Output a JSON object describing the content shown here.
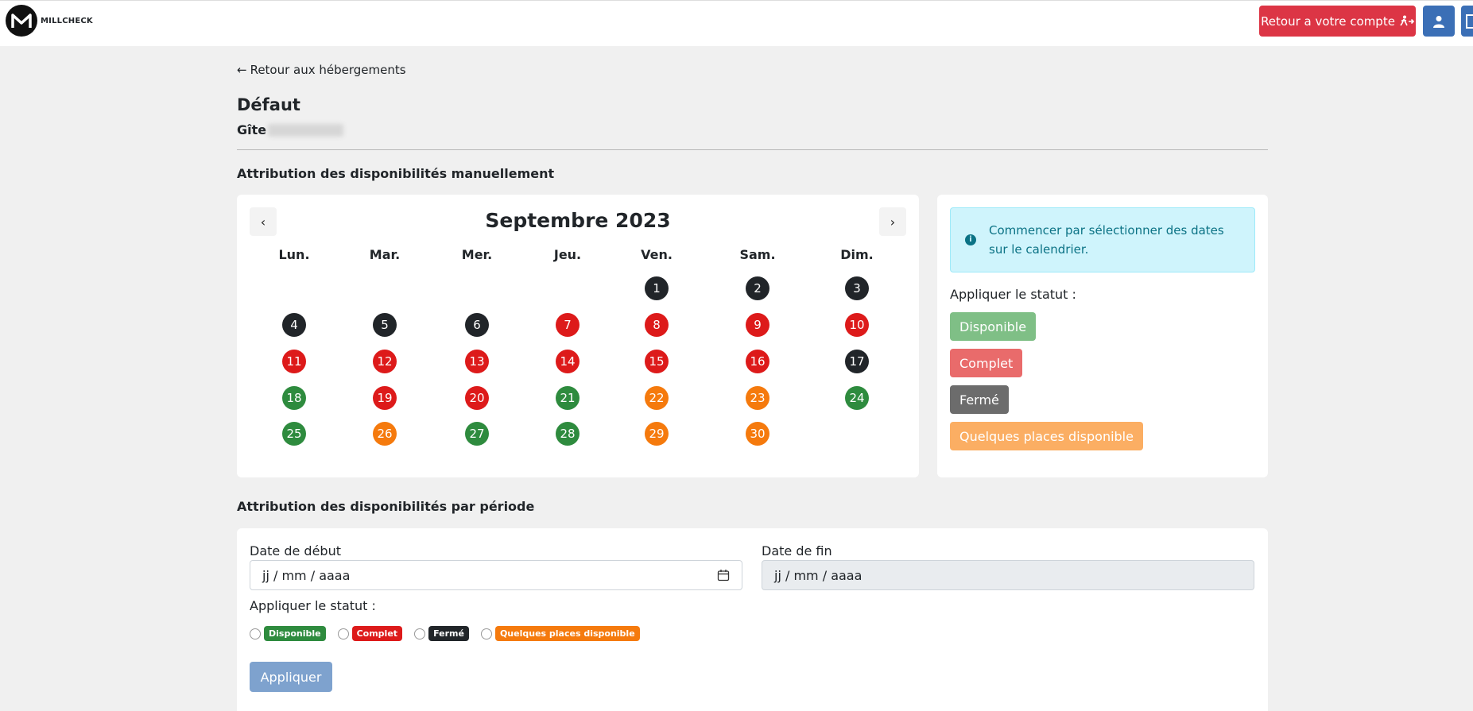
{
  "header": {
    "logo_text": "MILLCHECK",
    "return_button": "Retour a votre compte",
    "colors": {
      "return_bg": "#dc3545",
      "icon_btn_bg": "#3b6fb6"
    }
  },
  "back_link": "Retour aux hébergements",
  "page_title": "Défaut",
  "subtitle": "Gîte",
  "manual_section_title": "Attribution des disponibilités manuellement",
  "calendar": {
    "month": "Septembre 2023",
    "prev": "‹",
    "next": "›",
    "weekdays": [
      "Lun.",
      "Mar.",
      "Mer.",
      "Jeu.",
      "Ven.",
      "Sam.",
      "Dim."
    ],
    "days": [
      {
        "n": "1",
        "status": "black"
      },
      {
        "n": "2",
        "status": "black"
      },
      {
        "n": "3",
        "status": "black"
      },
      {
        "n": "4",
        "status": "black"
      },
      {
        "n": "5",
        "status": "black"
      },
      {
        "n": "6",
        "status": "black"
      },
      {
        "n": "7",
        "status": "red"
      },
      {
        "n": "8",
        "status": "red"
      },
      {
        "n": "9",
        "status": "red"
      },
      {
        "n": "10",
        "status": "red"
      },
      {
        "n": "11",
        "status": "red"
      },
      {
        "n": "12",
        "status": "red"
      },
      {
        "n": "13",
        "status": "red"
      },
      {
        "n": "14",
        "status": "red"
      },
      {
        "n": "15",
        "status": "red"
      },
      {
        "n": "16",
        "status": "red"
      },
      {
        "n": "17",
        "status": "black"
      },
      {
        "n": "18",
        "status": "green"
      },
      {
        "n": "19",
        "status": "red"
      },
      {
        "n": "20",
        "status": "red"
      },
      {
        "n": "21",
        "status": "green"
      },
      {
        "n": "22",
        "status": "orange"
      },
      {
        "n": "23",
        "status": "orange"
      },
      {
        "n": "24",
        "status": "green"
      },
      {
        "n": "25",
        "status": "green"
      },
      {
        "n": "26",
        "status": "orange"
      },
      {
        "n": "27",
        "status": "green"
      },
      {
        "n": "28",
        "status": "green"
      },
      {
        "n": "29",
        "status": "orange"
      },
      {
        "n": "30",
        "status": "orange"
      }
    ]
  },
  "status_panel": {
    "info": "Commencer par sélectionner des dates sur le calendrier.",
    "apply_label": "Appliquer le statut :",
    "buttons": [
      {
        "label": "Disponible",
        "color": "#7fbf86"
      },
      {
        "label": "Complet",
        "color": "#e96b6b"
      },
      {
        "label": "Fermé",
        "color": "#6c6c6c"
      },
      {
        "label": "Quelques places disponible",
        "color": "#fbae63"
      }
    ]
  },
  "period_section_title": "Attribution des disponibilités par période",
  "period": {
    "start_label": "Date de début",
    "start_placeholder": "jj / mm / aaaa",
    "end_label": "Date de fin",
    "end_placeholder": "jj / mm / aaaa",
    "apply_label": "Appliquer le statut :",
    "options": [
      {
        "label": "Disponible",
        "color": "#2e8b3e"
      },
      {
        "label": "Complet",
        "color": "#dd1a1a"
      },
      {
        "label": "Fermé",
        "color": "#212529"
      },
      {
        "label": "Quelques places disponible",
        "color": "#f57a0d"
      }
    ],
    "submit": "Appliquer"
  }
}
